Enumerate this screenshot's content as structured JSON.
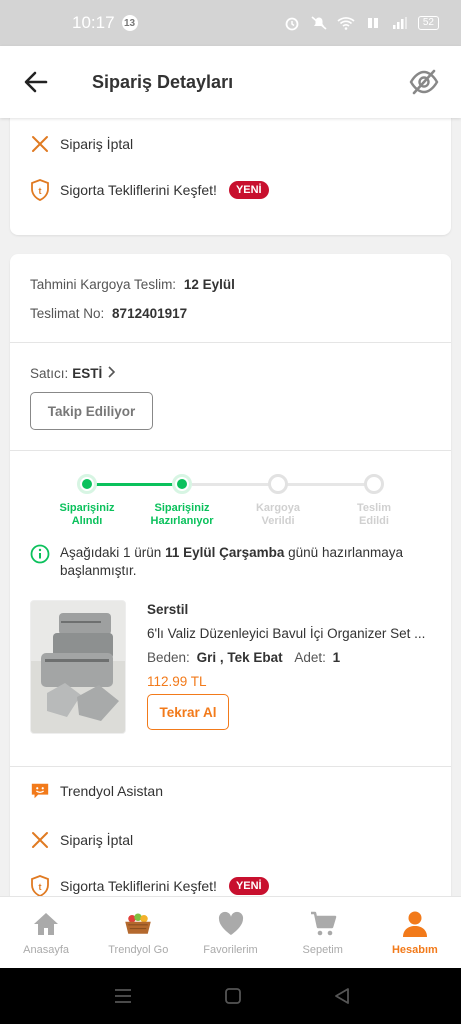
{
  "status_bar": {
    "time": "10:17",
    "notification_count": "13",
    "battery": "52"
  },
  "header": {
    "title": "Sipariş Detayları",
    "back_icon": "back-arrow-icon",
    "visibility_icon": "eye-off-icon"
  },
  "top_card": {
    "cancel_label": "Sipariş İptal",
    "insurance_label": "Sigorta Tekliflerini Keşfet!",
    "new_badge": "YENİ"
  },
  "delivery": {
    "estimate_label": "Tahmini Kargoya Teslim:",
    "estimate_value": "12 Eylül",
    "delivery_no_label": "Teslimat No:",
    "delivery_no_value": "8712401917",
    "seller_label": "Satıcı:",
    "seller_name": "ESTİ",
    "follow_button": "Takip Ediliyor"
  },
  "stepper": {
    "steps": [
      {
        "line1": "Siparişiniz",
        "line2": "Alındı",
        "state": "done"
      },
      {
        "line1": "Siparişiniz",
        "line2": "Hazırlanıyor",
        "state": "done"
      },
      {
        "line1": "Kargoya",
        "line2": "Verildi",
        "state": "todo"
      },
      {
        "line1": "Teslim",
        "line2": "Edildi",
        "state": "todo"
      }
    ],
    "colors": {
      "done": "#0bc15c",
      "todo": "#d0d0d0"
    }
  },
  "info": {
    "text_before": "Aşağıdaki 1 ürün ",
    "text_bold": "11 Eylül Çarşamba",
    "text_after": " günü hazırlanmaya başlanmıştır."
  },
  "product": {
    "brand": "Serstil",
    "name": "6'lı Valiz Düzenleyici Bavul İçi Organizer Set ...",
    "size_label": "Beden:",
    "size_value": "Gri , Tek Ebat",
    "qty_label": "Adet:",
    "qty_value": "1",
    "price": "112.99 TL",
    "reorder_button": "Tekrar Al"
  },
  "bottom_card": {
    "assistant_label": "Trendyol Asistan",
    "cancel_label": "Sipariş İptal",
    "insurance_label": "Sigorta Tekliflerini Keşfet!",
    "new_badge": "YENİ"
  },
  "bottom_nav": {
    "items": [
      {
        "label": "Anasayfa",
        "icon": "home-icon"
      },
      {
        "label": "Trendyol Go",
        "icon": "grocery-basket-icon"
      },
      {
        "label": "Favorilerim",
        "icon": "heart-icon"
      },
      {
        "label": "Sepetim",
        "icon": "cart-icon"
      },
      {
        "label": "Hesabım",
        "icon": "user-icon"
      }
    ],
    "active_index": 4
  },
  "colors": {
    "accent": "#f27a1a",
    "success": "#0bc15c",
    "badge": "#c8102e"
  }
}
